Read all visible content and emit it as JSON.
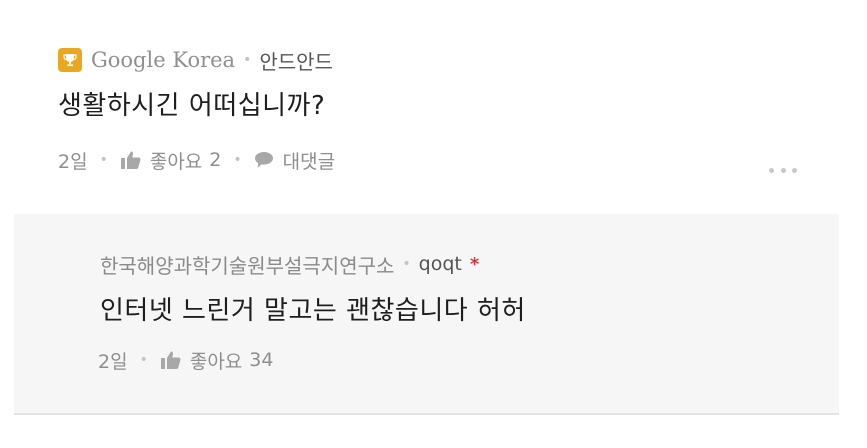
{
  "comment": {
    "author": "Google Korea",
    "author_icon": "trophy-icon",
    "badge_color": "#e9a820",
    "nickname": "안드안드",
    "text": "생활하시긴 어떠십니까?",
    "time": "2일",
    "like_label": "좋아요",
    "like_count": "2",
    "reply_label": "대댓글",
    "more_icon": "more-dots-icon"
  },
  "reply": {
    "author": "한국해양과학기술원부설극지연구소",
    "nickname": "qoqt",
    "op_mark": "*",
    "text": "인터넷 느린거 말고는 괜찮습니다 허허",
    "time": "2일",
    "like_label": "좋아요",
    "like_count": "34"
  },
  "colors": {
    "reply_background": "#f6f6f6",
    "op_mark": "#d03a3a",
    "muted_text": "#8e8e8e"
  }
}
